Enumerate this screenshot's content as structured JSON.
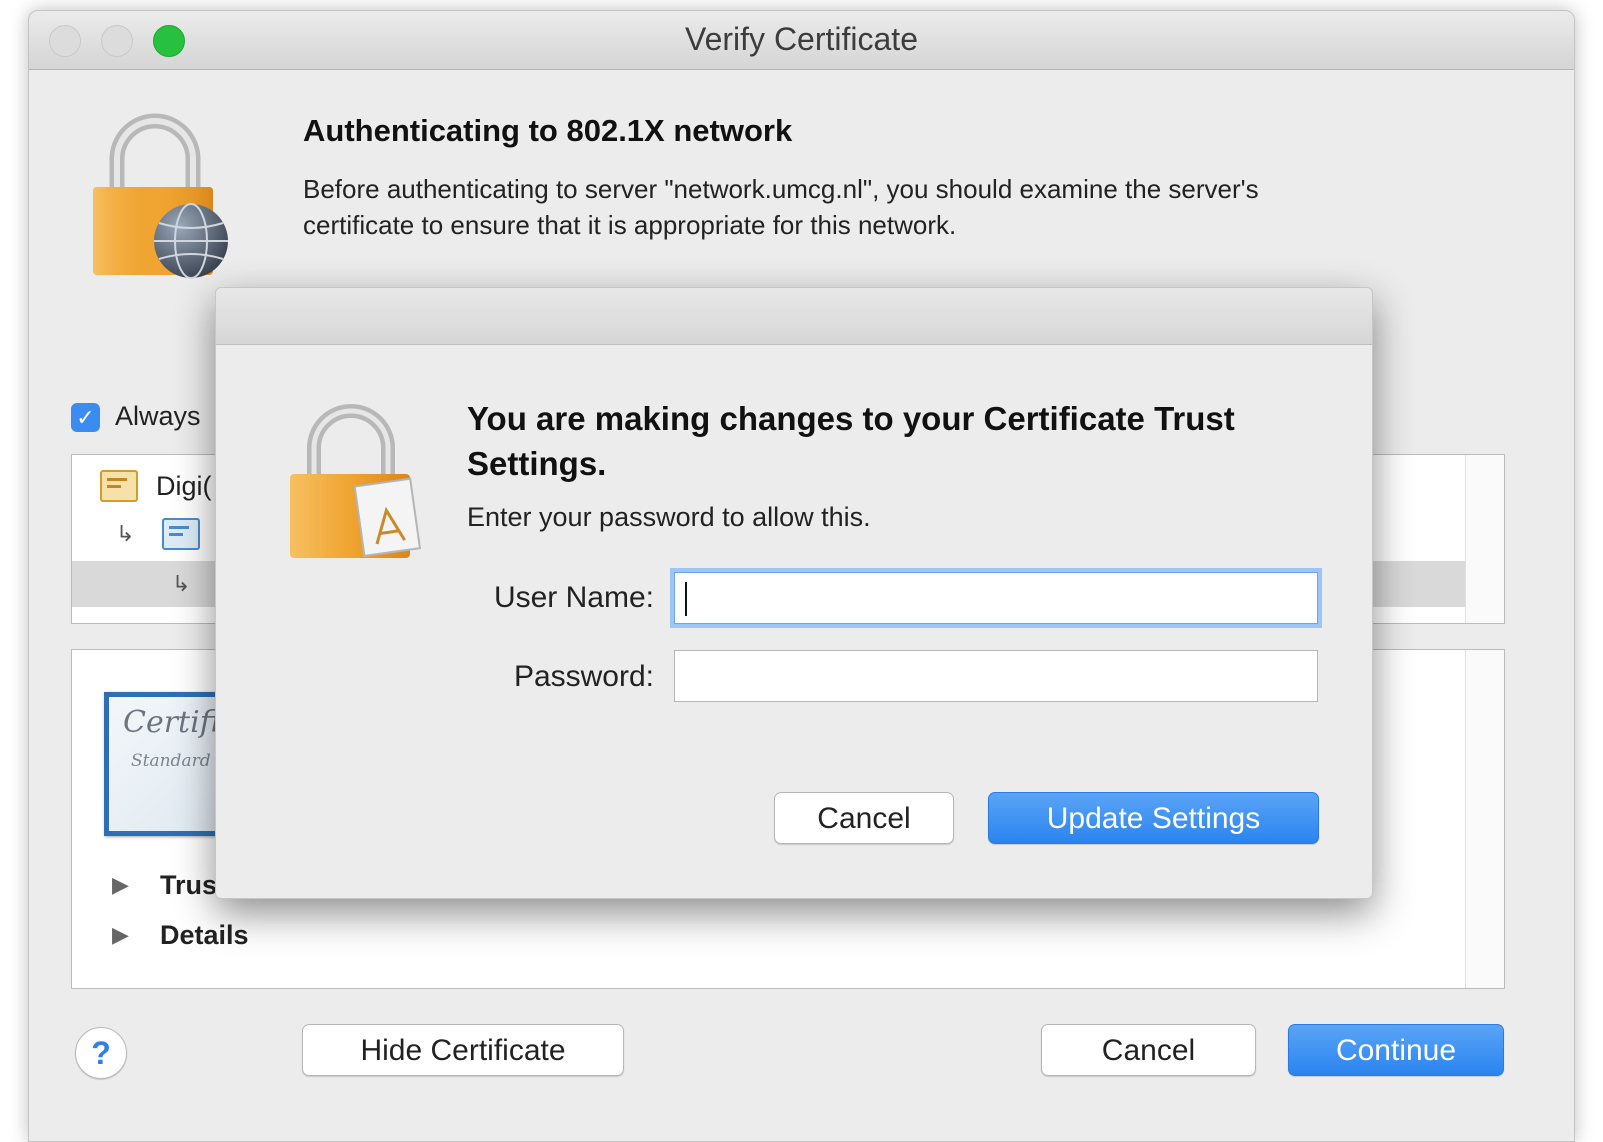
{
  "window": {
    "title": "Verify Certificate",
    "heading": "Authenticating to 802.1X network",
    "description_lines": [
      "Before authenticating to server \"network.umcg.nl\", you should examine the server's",
      "certificate to ensure that it is appropriate for this network."
    ],
    "always_trust": {
      "checked": true,
      "label": "Always"
    },
    "chain": [
      {
        "text": "Digi(",
        "icon": "certificate-icon"
      },
      {
        "text": "",
        "icon": "certificate-blue-icon"
      },
      {
        "text": "",
        "icon": "arrow-sub-icon"
      }
    ],
    "cert_image": {
      "script_top": "Certific",
      "script_bottom": "Standard"
    },
    "sections": [
      {
        "label": "Trus"
      },
      {
        "label": "Details"
      }
    ],
    "buttons": {
      "help": "?",
      "hide_certificate": "Hide Certificate",
      "cancel": "Cancel",
      "continue": "Continue"
    }
  },
  "auth_sheet": {
    "heading_lines": [
      "You are making changes to your Certificate Trust",
      "Settings."
    ],
    "subtitle": "Enter your password to allow this.",
    "user_name_label": "User Name:",
    "user_name_value": "",
    "password_label": "Password:",
    "password_value": "",
    "cancel": "Cancel",
    "update": "Update Settings"
  },
  "colors": {
    "accent": "#2a84ef",
    "zoom_button": "#27c13f",
    "focus_ring": "#9cc7f4"
  }
}
